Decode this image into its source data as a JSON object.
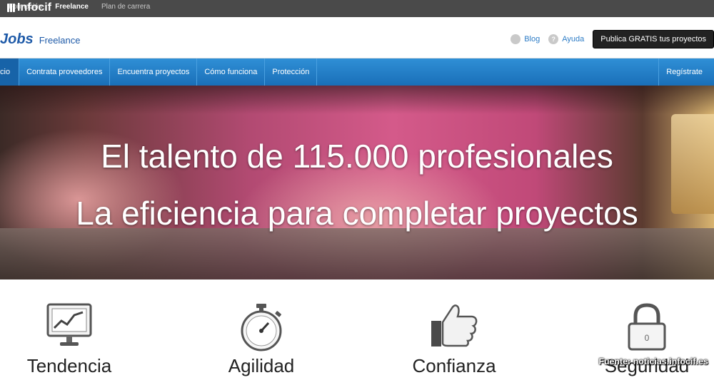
{
  "watermark_brand": "Infocif",
  "top_nav": [
    {
      "label": "Formación",
      "active": false
    },
    {
      "label": "Freelance",
      "active": true
    },
    {
      "label": "Plan de carrera",
      "active": false
    }
  ],
  "header": {
    "logo_text": "Jobs",
    "logo_sub": "Freelance",
    "blog_label": "Blog",
    "help_label": "Ayuda",
    "publish_button": "Publica GRATIS tus proyectos"
  },
  "main_nav": {
    "items": [
      "cio",
      "Contrata proveedores",
      "Encuentra proyectos",
      "Cómo funciona",
      "Protección"
    ],
    "register": "Regístrate"
  },
  "hero": {
    "line1": "El talento de 115.000 profesionales",
    "line2": "La eficiencia para completar proyectos"
  },
  "features": [
    {
      "label": "Tendencia",
      "icon": "trend-chart-icon"
    },
    {
      "label": "Agilidad",
      "icon": "stopwatch-icon"
    },
    {
      "label": "Confianza",
      "icon": "thumbs-up-icon"
    },
    {
      "label": "Seguridad",
      "icon": "padlock-icon"
    }
  ],
  "padlock_digit": "0",
  "source_caption": "Fuente: noticias.infocif.es",
  "colors": {
    "accent_blue": "#1e5aa8",
    "nav_blue": "#2f8fd6",
    "dark_button": "#222222"
  }
}
